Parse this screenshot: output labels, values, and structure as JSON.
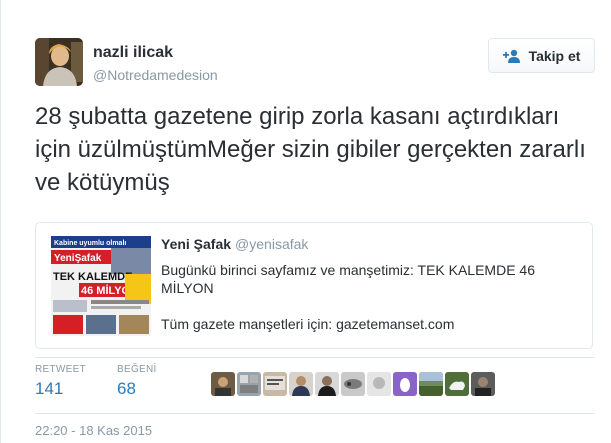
{
  "author": {
    "display_name": "nazli ilicak",
    "screen_name": "@Notredamedesion"
  },
  "follow_button": {
    "label": "Takip et",
    "icon": "add-user-icon"
  },
  "tweet": {
    "text": "28 şubatta gazetene girip zorla kasanı açtırdıkları için üzülmüştümMeğer sizin gibiler gerçekten zararlı ve kötüymüş"
  },
  "quoted_tweet": {
    "display_name": "Yeni Şafak",
    "screen_name": "@yenisafak",
    "line1": "Bugünkü birinci sayfamız ve manşetimiz: TEK KALEMDE 46 MİLYON",
    "line2": "Tüm gazete manşetleri için: gazetemanset.com",
    "thumbnail": {
      "header_text": "Kabine uyumlu olmalı",
      "masthead": "YeniŞafak",
      "headline1": "TEK KALEMDE",
      "headline2": "46 MİLYON"
    }
  },
  "stats": {
    "retweet_label": "RETWEET",
    "retweet_count": "141",
    "like_label": "BEĞENİ",
    "like_count": "68"
  },
  "timestamp": "22:20 - 18 Kas 2015",
  "colors": {
    "link_blue": "#2b7bb9",
    "muted": "#8899a6",
    "border": "#e1e8ed",
    "text": "#292f33"
  }
}
